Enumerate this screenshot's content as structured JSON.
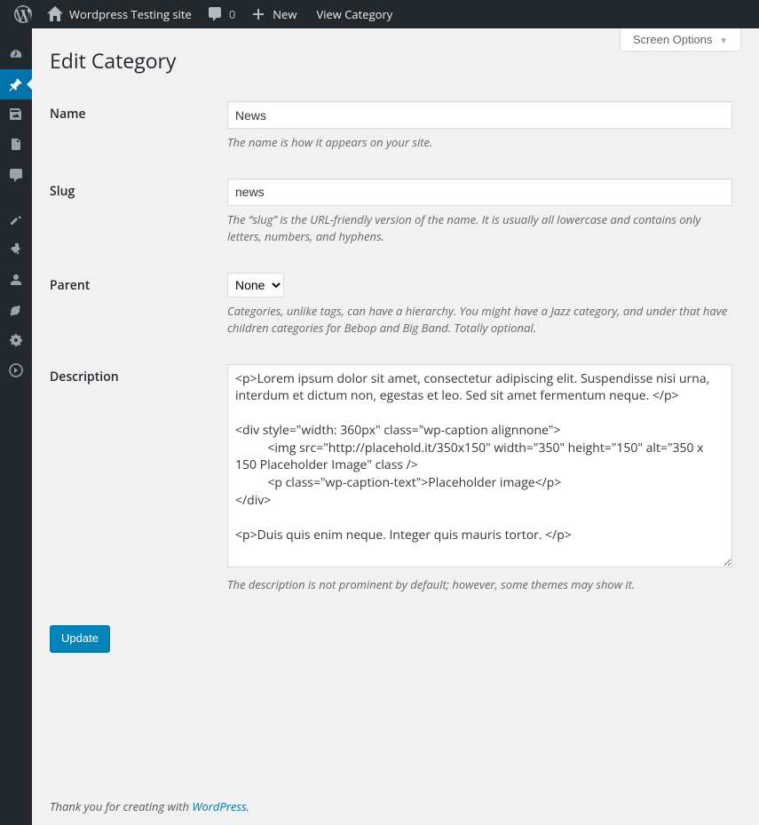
{
  "adminbar": {
    "site_name": "Wordpress Testing site",
    "comments_count": "0",
    "new_label": "New",
    "view_category": "View Category"
  },
  "screen_options_label": "Screen Options",
  "page_title": "Edit Category",
  "fields": {
    "name": {
      "label": "Name",
      "value": "News",
      "description": "The name is how it appears on your site."
    },
    "slug": {
      "label": "Slug",
      "value": "news",
      "description": "The “slug” is the URL-friendly version of the name. It is usually all lowercase and contains only letters, numbers, and hyphens."
    },
    "parent": {
      "label": "Parent",
      "value": "None",
      "description": "Categories, unlike tags, can have a hierarchy. You might have a Jazz category, and under that have children categories for Bebop and Big Band. Totally optional."
    },
    "description": {
      "label": "Description",
      "value": "<p>Lorem ipsum dolor sit amet, consectetur adipiscing elit. Suspendisse nisi urna, interdum et dictum non, egestas et leo. Sed sit amet fermentum neque. </p>\n\n<div style=\"width: 360px\" class=\"wp-caption alignnone\">\n          <img src=\"http://placehold.it/350x150\" width=\"350\" height=\"150\" alt=\"350 x 150 Placeholder Image\" class />\n          <p class=\"wp-caption-text\">Placeholder image</p>\n</div>\n\n<p>Duis quis enim neque. Integer quis mauris tortor. </p>",
      "description": "The description is not prominent by default; however, some themes may show it."
    }
  },
  "submit_label": "Update",
  "footer": {
    "text": "Thank you for creating with ",
    "link_text": "WordPress",
    "suffix": "."
  }
}
